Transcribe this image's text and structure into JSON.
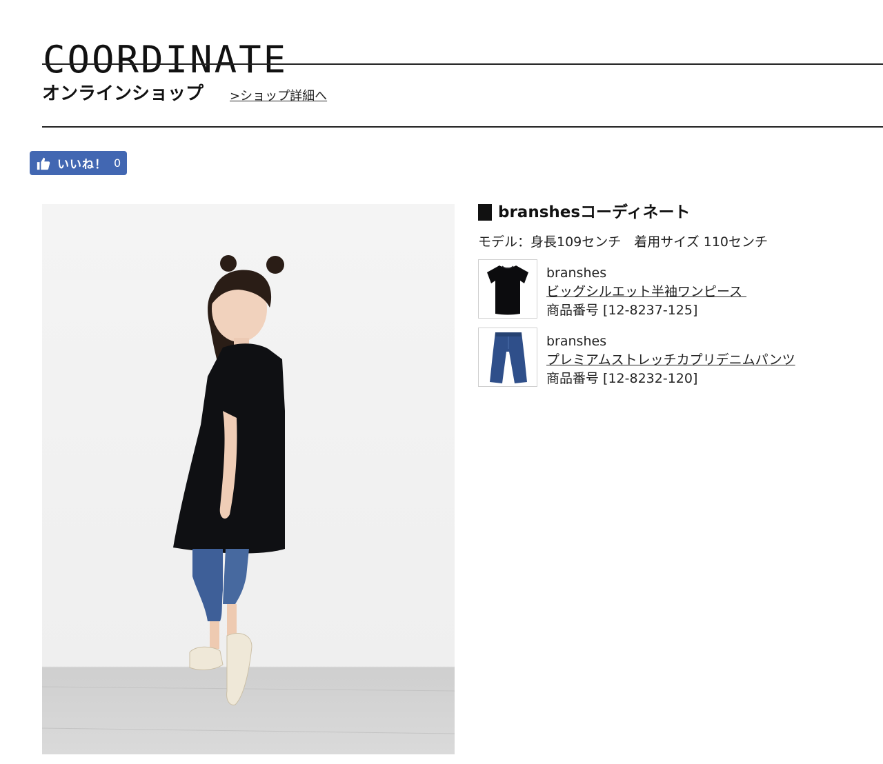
{
  "header": {
    "title": "COORDINATE",
    "shop_heading": "オンラインショップ",
    "shop_link": ">ショップ詳細へ"
  },
  "like_button": {
    "label": "いいね！",
    "count": "0",
    "icon": "thumbs-up-icon",
    "color": "#4267b2"
  },
  "main_photo": {
    "icon": "model-photo"
  },
  "coordinate": {
    "title": "branshesコーディネート",
    "model_info": "モデル：身長109センチ　着用サイズ 110センチ",
    "items": [
      {
        "brand": "branshes",
        "name": "ビッグシルエット半袖ワンピース ",
        "product_no": "商品番号 [12-8237-125]",
        "thumb_icon": "black-dress-thumbnail"
      },
      {
        "brand": "branshes",
        "name": "プレミアムストレッチカプリデニムパンツ",
        "product_no": "商品番号 [12-8232-120]",
        "thumb_icon": "denim-pants-thumbnail"
      }
    ]
  }
}
